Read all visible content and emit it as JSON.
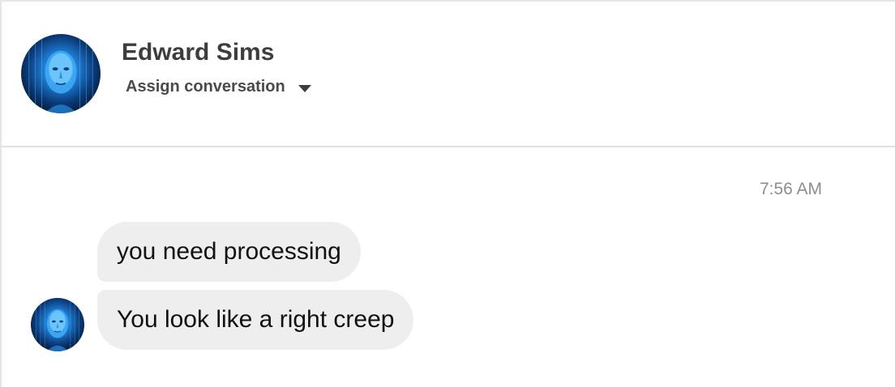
{
  "contact": {
    "name": "Edward Sims",
    "assign_label": "Assign conversation",
    "avatar_icon": "digital-face-avatar"
  },
  "conversation": {
    "timestamp": "7:56 AM",
    "messages": [
      {
        "text": "you need processing"
      },
      {
        "text": "You look like a right creep"
      }
    ]
  },
  "colors": {
    "bubble_bg": "#eeeeee",
    "divider": "#e2e2e2",
    "avatar_glow": "#3aa8ff"
  }
}
